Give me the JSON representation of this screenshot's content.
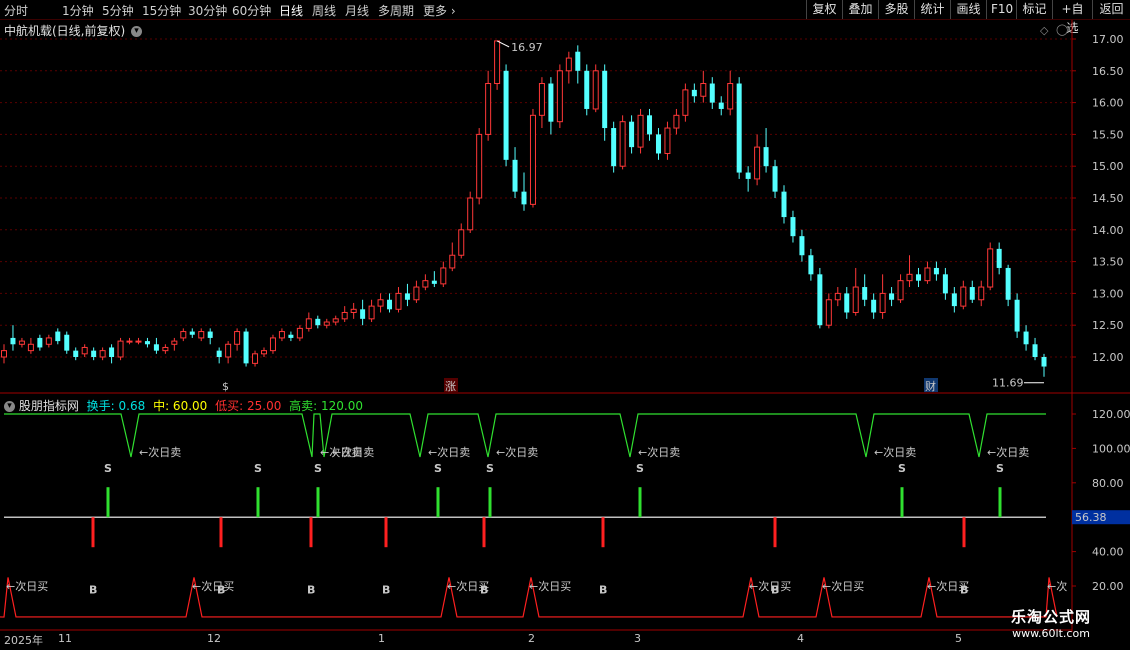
{
  "toolbar": {
    "periods": [
      "分时",
      "1分钟",
      "5分钟",
      "15分钟",
      "30分钟",
      "60分钟",
      "日线",
      "周线",
      "月线",
      "多周期",
      "更多"
    ],
    "active_period": "日线",
    "right_buttons": [
      "复权",
      "叠加",
      "多股",
      "统计",
      "画线",
      "F10",
      "标记",
      "+自选",
      "返回"
    ]
  },
  "stock": {
    "title": "中航机载(日线,前复权)",
    "high_label": "16.97",
    "low_label": "11.69"
  },
  "markers": {
    "zhang": "涨",
    "cai": "财"
  },
  "indicator": {
    "name": "股朋指标网",
    "legend": [
      {
        "label": "换手: 0.68",
        "color": "#00e0e0"
      },
      {
        "label": "中: 60.00",
        "color": "#ffff00"
      },
      {
        "label": "低买: 25.00",
        "color": "#ff3030"
      },
      {
        "label": "高卖: 120.00",
        "color": "#30e030"
      }
    ],
    "current_value": "56.38",
    "sell_text": "←次日卖",
    "buy_text": "←次日买",
    "sell_letter": "S",
    "buy_letter": "B",
    "buy_cut": "←次",
    "sell_signals": [
      127,
      308,
      320,
      416,
      484,
      626,
      862,
      975
    ],
    "sell_bars": [
      108,
      258,
      318,
      438,
      490,
      640,
      902,
      1000
    ],
    "buy_bars": [
      93,
      221,
      311,
      386,
      484,
      603,
      775,
      964
    ],
    "buy_signals": [
      4,
      190,
      445,
      527,
      747,
      820,
      925,
      1045
    ]
  },
  "price_axis": [
    "17.00",
    "16.50",
    "16.00",
    "15.50",
    "15.00",
    "14.50",
    "14.00",
    "13.50",
    "13.00",
    "12.50",
    "12.00"
  ],
  "ind_axis": [
    "120.00",
    "100.00",
    "80.00",
    "40.00",
    "20.00"
  ],
  "dates": [
    {
      "t": "2025年",
      "x": 4
    },
    {
      "t": "11",
      "x": 58
    },
    {
      "t": "12",
      "x": 207
    },
    {
      "t": "1",
      "x": 378
    },
    {
      "t": "2",
      "x": 528
    },
    {
      "t": "3",
      "x": 634
    },
    {
      "t": "4",
      "x": 797
    },
    {
      "t": "5",
      "x": 955
    }
  ],
  "watermark": {
    "line1": "乐淘公式网",
    "line2": "www.60lt.com"
  },
  "chart_data": {
    "type": "candlestick",
    "title": "中航机载(日线,前复权)",
    "ylim": [
      11.7,
      17.1
    ],
    "annotations": {
      "max": 16.97,
      "min": 11.69
    },
    "candles": [
      [
        12.0,
        12.1,
        11.9,
        12.2
      ],
      [
        12.3,
        12.2,
        12.1,
        12.5
      ],
      [
        12.2,
        12.25,
        12.15,
        12.3
      ],
      [
        12.1,
        12.2,
        12.05,
        12.3
      ],
      [
        12.3,
        12.15,
        12.1,
        12.35
      ],
      [
        12.2,
        12.3,
        12.15,
        12.35
      ],
      [
        12.4,
        12.25,
        12.2,
        12.45
      ],
      [
        12.35,
        12.1,
        12.05,
        12.4
      ],
      [
        12.1,
        12.0,
        11.95,
        12.15
      ],
      [
        12.05,
        12.15,
        12.0,
        12.2
      ],
      [
        12.1,
        12.0,
        11.95,
        12.15
      ],
      [
        12.0,
        12.1,
        11.95,
        12.15
      ],
      [
        12.15,
        12.0,
        11.9,
        12.2
      ],
      [
        12.0,
        12.25,
        11.95,
        12.3
      ],
      [
        12.25,
        12.25,
        12.2,
        12.3
      ],
      [
        12.25,
        12.25,
        12.2,
        12.3
      ],
      [
        12.25,
        12.2,
        12.15,
        12.3
      ],
      [
        12.2,
        12.1,
        12.05,
        12.3
      ],
      [
        12.1,
        12.15,
        12.05,
        12.2
      ],
      [
        12.2,
        12.25,
        12.1,
        12.3
      ],
      [
        12.3,
        12.4,
        12.25,
        12.45
      ],
      [
        12.4,
        12.35,
        12.3,
        12.45
      ],
      [
        12.3,
        12.4,
        12.25,
        12.45
      ],
      [
        12.4,
        12.3,
        12.2,
        12.45
      ],
      [
        12.1,
        12.0,
        11.9,
        12.15
      ],
      [
        12.0,
        12.2,
        11.9,
        12.25
      ],
      [
        12.2,
        12.4,
        12.1,
        12.45
      ],
      [
        12.4,
        11.9,
        11.85,
        12.45
      ],
      [
        11.9,
        12.05,
        11.85,
        12.1
      ],
      [
        12.05,
        12.1,
        12.0,
        12.15
      ],
      [
        12.1,
        12.3,
        12.05,
        12.35
      ],
      [
        12.3,
        12.4,
        12.25,
        12.45
      ],
      [
        12.35,
        12.3,
        12.25,
        12.4
      ],
      [
        12.3,
        12.45,
        12.25,
        12.5
      ],
      [
        12.45,
        12.6,
        12.4,
        12.7
      ],
      [
        12.6,
        12.5,
        12.45,
        12.65
      ],
      [
        12.5,
        12.55,
        12.45,
        12.6
      ],
      [
        12.55,
        12.6,
        12.5,
        12.65
      ],
      [
        12.6,
        12.7,
        12.55,
        12.8
      ],
      [
        12.7,
        12.75,
        12.6,
        12.85
      ],
      [
        12.75,
        12.6,
        12.5,
        12.9
      ],
      [
        12.6,
        12.8,
        12.55,
        12.9
      ],
      [
        12.8,
        12.9,
        12.7,
        13.0
      ],
      [
        12.9,
        12.75,
        12.7,
        13.0
      ],
      [
        12.75,
        13.0,
        12.7,
        13.1
      ],
      [
        13.0,
        12.9,
        12.8,
        13.15
      ],
      [
        12.9,
        13.1,
        12.85,
        13.2
      ],
      [
        13.1,
        13.2,
        13.05,
        13.3
      ],
      [
        13.2,
        13.15,
        13.1,
        13.35
      ],
      [
        13.15,
        13.4,
        13.1,
        13.5
      ],
      [
        13.4,
        13.6,
        13.35,
        13.8
      ],
      [
        13.6,
        14.0,
        13.55,
        14.1
      ],
      [
        14.0,
        14.5,
        13.95,
        14.6
      ],
      [
        14.5,
        15.5,
        14.4,
        15.6
      ],
      [
        15.5,
        16.3,
        15.4,
        16.5
      ],
      [
        16.3,
        16.97,
        16.2,
        16.97
      ],
      [
        16.5,
        15.1,
        15.0,
        16.6
      ],
      [
        15.1,
        14.6,
        14.5,
        15.3
      ],
      [
        14.6,
        14.4,
        14.3,
        14.9
      ],
      [
        14.4,
        15.8,
        14.35,
        15.9
      ],
      [
        15.8,
        16.3,
        15.6,
        16.4
      ],
      [
        16.3,
        15.7,
        15.5,
        16.4
      ],
      [
        15.7,
        16.5,
        15.6,
        16.6
      ],
      [
        16.5,
        16.7,
        16.3,
        16.8
      ],
      [
        16.8,
        16.5,
        16.3,
        16.9
      ],
      [
        16.5,
        15.9,
        15.8,
        16.6
      ],
      [
        15.9,
        16.5,
        15.85,
        16.6
      ],
      [
        16.5,
        15.6,
        15.4,
        16.6
      ],
      [
        15.6,
        15.0,
        14.9,
        15.7
      ],
      [
        15.0,
        15.7,
        14.95,
        15.8
      ],
      [
        15.7,
        15.3,
        15.2,
        15.8
      ],
      [
        15.3,
        15.8,
        15.2,
        15.9
      ],
      [
        15.8,
        15.5,
        15.4,
        15.9
      ],
      [
        15.5,
        15.2,
        15.1,
        15.6
      ],
      [
        15.2,
        15.6,
        15.1,
        15.7
      ],
      [
        15.6,
        15.8,
        15.5,
        15.9
      ],
      [
        15.8,
        16.2,
        15.7,
        16.3
      ],
      [
        16.2,
        16.1,
        16.0,
        16.3
      ],
      [
        16.1,
        16.3,
        16.0,
        16.5
      ],
      [
        16.3,
        16.0,
        15.9,
        16.4
      ],
      [
        16.0,
        15.9,
        15.8,
        16.1
      ],
      [
        15.9,
        16.3,
        15.8,
        16.5
      ],
      [
        16.3,
        14.9,
        14.8,
        16.4
      ],
      [
        14.9,
        14.8,
        14.6,
        15.0
      ],
      [
        14.8,
        15.3,
        14.7,
        15.5
      ],
      [
        15.3,
        15.0,
        14.9,
        15.6
      ],
      [
        15.0,
        14.6,
        14.5,
        15.1
      ],
      [
        14.6,
        14.2,
        14.1,
        14.7
      ],
      [
        14.2,
        13.9,
        13.8,
        14.3
      ],
      [
        13.9,
        13.6,
        13.5,
        14.0
      ],
      [
        13.6,
        13.3,
        13.2,
        13.7
      ],
      [
        13.3,
        12.5,
        12.45,
        13.4
      ],
      [
        12.5,
        12.9,
        12.45,
        13.0
      ],
      [
        12.9,
        13.0,
        12.8,
        13.1
      ],
      [
        13.0,
        12.7,
        12.6,
        13.1
      ],
      [
        12.7,
        13.1,
        12.65,
        13.4
      ],
      [
        13.1,
        12.9,
        12.8,
        13.3
      ],
      [
        12.9,
        12.7,
        12.6,
        13.0
      ],
      [
        12.7,
        13.0,
        12.6,
        13.3
      ],
      [
        13.0,
        12.9,
        12.8,
        13.1
      ],
      [
        12.9,
        13.2,
        12.85,
        13.3
      ],
      [
        13.2,
        13.3,
        13.1,
        13.6
      ],
      [
        13.3,
        13.2,
        13.1,
        13.4
      ],
      [
        13.2,
        13.4,
        13.15,
        13.5
      ],
      [
        13.4,
        13.3,
        13.2,
        13.5
      ],
      [
        13.3,
        13.0,
        12.9,
        13.4
      ],
      [
        13.0,
        12.8,
        12.7,
        13.1
      ],
      [
        12.8,
        13.1,
        12.75,
        13.2
      ],
      [
        13.1,
        12.9,
        12.85,
        13.2
      ],
      [
        12.9,
        13.1,
        12.8,
        13.2
      ],
      [
        13.1,
        13.7,
        13.05,
        13.8
      ],
      [
        13.7,
        13.4,
        13.3,
        13.8
      ],
      [
        13.4,
        12.9,
        12.8,
        13.45
      ],
      [
        12.9,
        12.4,
        12.3,
        13.0
      ],
      [
        12.4,
        12.2,
        12.1,
        12.5
      ],
      [
        12.2,
        12.0,
        11.95,
        12.3
      ],
      [
        12.0,
        11.85,
        11.69,
        12.05
      ]
    ],
    "indicator_ylim": [
      0,
      130
    ]
  }
}
